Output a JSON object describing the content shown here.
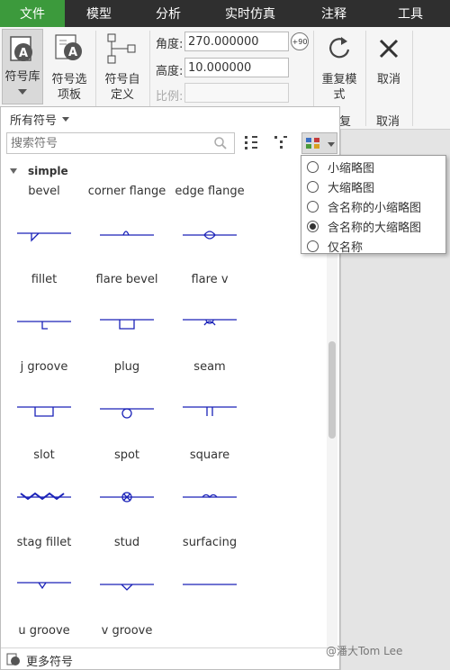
{
  "menu": {
    "tabs": [
      {
        "label": "文件",
        "active": true
      },
      {
        "label": "模型"
      },
      {
        "label": "分析"
      },
      {
        "label": "实时仿真"
      },
      {
        "label": "注释"
      },
      {
        "label": "工具"
      }
    ]
  },
  "ribbon": {
    "symbol_library": "符号库",
    "symbol_options_line1": "符号选",
    "symbol_options_line2": "项板",
    "symbol_custom_line1": "符号自",
    "symbol_custom_line2": "定义",
    "angle_label": "角度:",
    "angle_value": "270.000000",
    "angle_badge": "+90",
    "height_label": "高度:",
    "height_value": "10.000000",
    "scale_label": "比例:",
    "scale_value": "",
    "repeat_line1": "重复模",
    "repeat_line2": "式",
    "repeat_group_label": "复",
    "cancel_label": "取消",
    "cancel_group_label": "取消"
  },
  "panel": {
    "filter_label": "所有符号",
    "search_placeholder": "搜索符号",
    "group_title": "simple",
    "footer_label": "更多符号",
    "symbols": [
      {
        "name": "bevel",
        "shape": "bevel"
      },
      {
        "name": "corner flange",
        "shape": "corner-flange"
      },
      {
        "name": "edge flange",
        "shape": "edge-flange"
      },
      {
        "name": "fillet",
        "shape": "fillet"
      },
      {
        "name": "flare bevel",
        "shape": "flare-bevel"
      },
      {
        "name": "flare v",
        "shape": "flare-v"
      },
      {
        "name": "j groove",
        "shape": "j-groove"
      },
      {
        "name": "plug",
        "shape": "plug"
      },
      {
        "name": "seam",
        "shape": "seam"
      },
      {
        "name": "slot",
        "shape": "slot"
      },
      {
        "name": "spot",
        "shape": "spot"
      },
      {
        "name": "square",
        "shape": "square"
      },
      {
        "name": "stag fillet",
        "shape": "stag-fillet"
      },
      {
        "name": "stud",
        "shape": "stud"
      },
      {
        "name": "surfacing",
        "shape": "surfacing"
      },
      {
        "name": "u groove",
        "shape": "u-groove"
      },
      {
        "name": "v groove",
        "shape": "v-groove"
      }
    ]
  },
  "view_menu": {
    "options": [
      {
        "label": "小缩略图",
        "checked": false
      },
      {
        "label": "大缩略图",
        "checked": false
      },
      {
        "label": "含名称的小缩略图",
        "checked": false
      },
      {
        "label": "含名称的大缩略图",
        "checked": true
      },
      {
        "label": "仅名称",
        "checked": false
      }
    ]
  },
  "watermark": "@潘大Tom Lee",
  "colors": {
    "active_tab": "#3c9a3c",
    "menubar": "#2f2f2f",
    "symbol_stroke": "#1a22b8"
  }
}
